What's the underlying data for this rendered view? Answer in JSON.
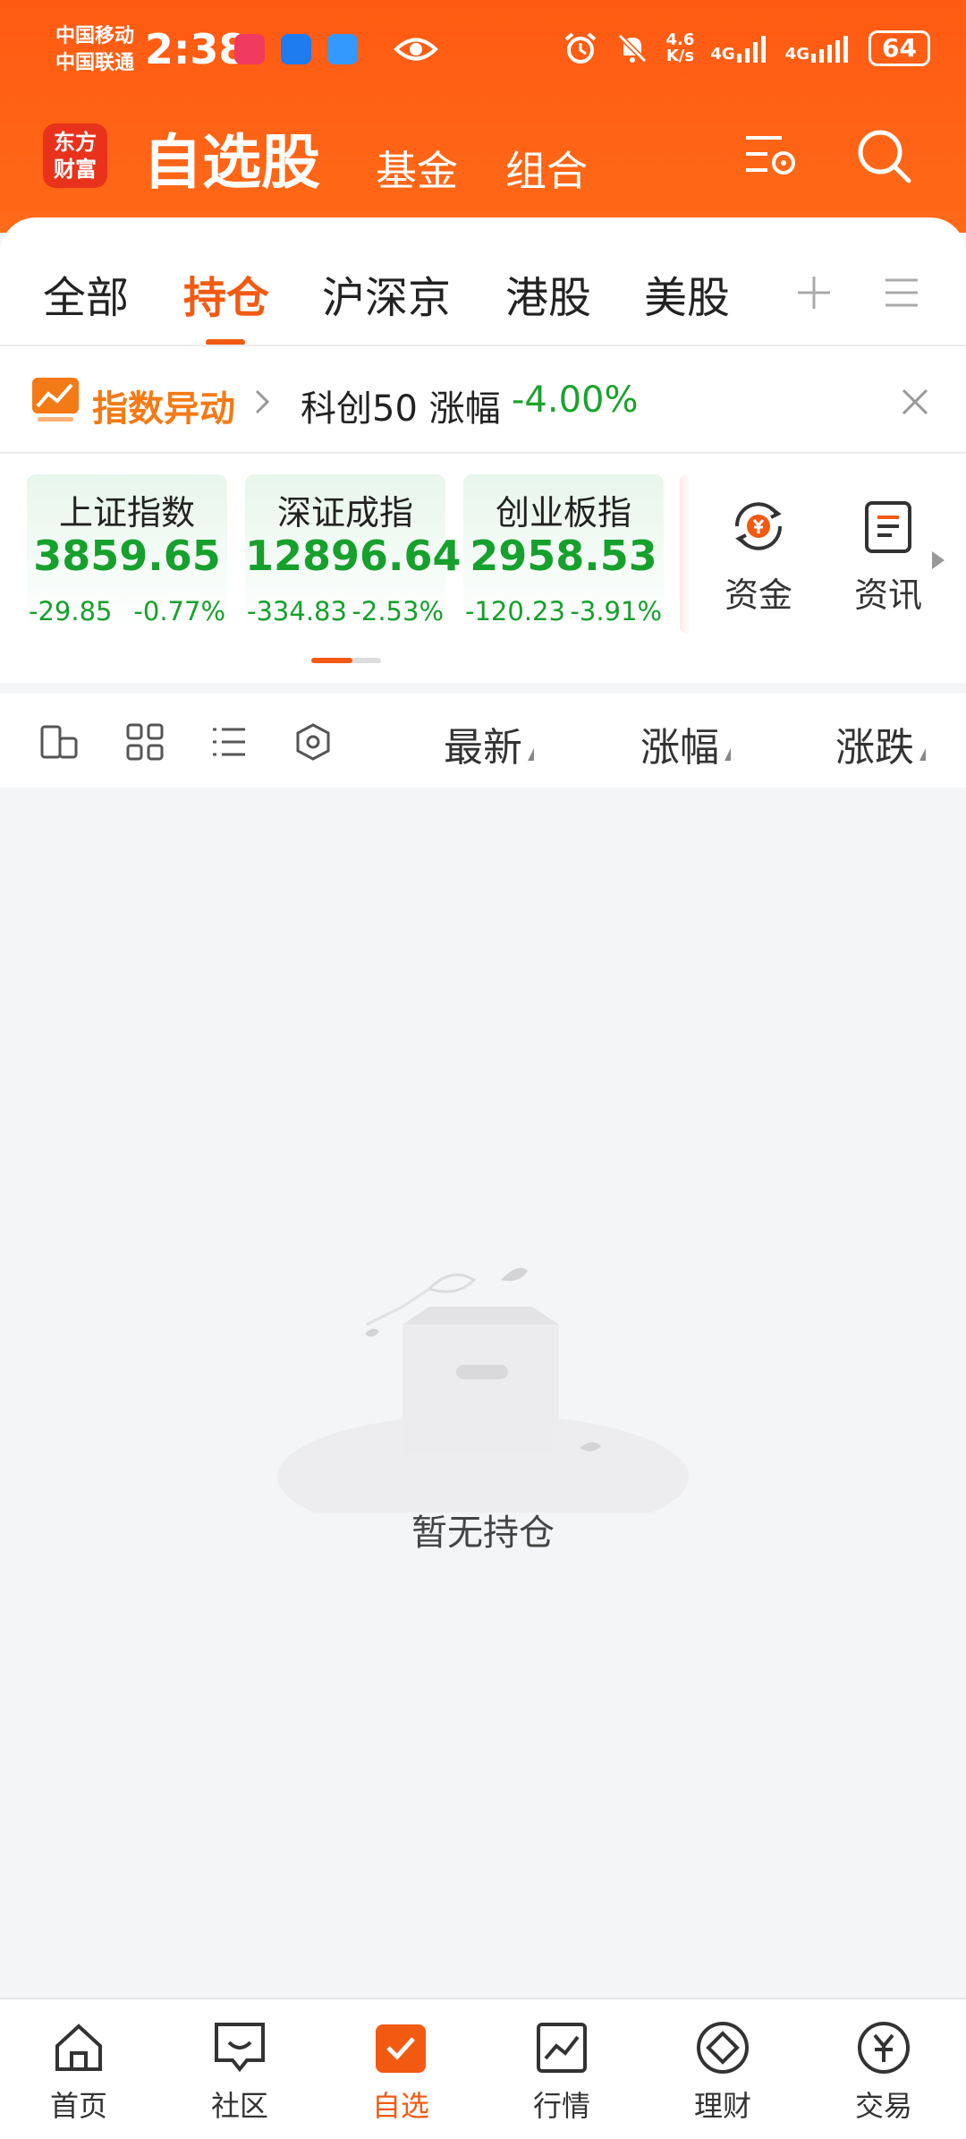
{
  "status_bar": {
    "carrier_1": "中国移动",
    "carrier_2": "中国联通",
    "time": "2:38",
    "net_speed_value": "4.6",
    "net_speed_unit": "K/s",
    "net_1": "4G",
    "net_2": "4G",
    "battery": "64"
  },
  "header": {
    "logo_line1": "东方",
    "logo_line2": "财富",
    "title": "自选股",
    "tab_fund": "基金",
    "tab_portfolio": "组合"
  },
  "tabs": [
    {
      "label": "全部",
      "active": false
    },
    {
      "label": "持仓",
      "active": true
    },
    {
      "label": "沪深京",
      "active": false
    },
    {
      "label": "港股",
      "active": false
    },
    {
      "label": "美股",
      "active": false
    }
  ],
  "alert": {
    "label": "指数异动",
    "text": "科创50 涨幅",
    "percent": "-4.00%"
  },
  "indices": [
    {
      "name": "上证指数",
      "value": "3859.65",
      "change": "-29.85",
      "percent": "-0.77%"
    },
    {
      "name": "深证成指",
      "value": "12896.64",
      "change": "-334.83",
      "percent": "-2.53%"
    },
    {
      "name": "创业板指",
      "value": "2958.53",
      "change": "-120.23",
      "percent": "-3.91%"
    }
  ],
  "quick_links": {
    "funds": "资金",
    "news": "资讯"
  },
  "columns": {
    "latest": "最新",
    "change_pct": "涨幅",
    "change": "涨跌"
  },
  "empty_state": {
    "text": "暂无持仓"
  },
  "bottom_nav": [
    {
      "label": "首页",
      "icon": "home-icon",
      "active": false
    },
    {
      "label": "社区",
      "icon": "community-icon",
      "active": false
    },
    {
      "label": "自选",
      "icon": "watchlist-icon",
      "active": true
    },
    {
      "label": "行情",
      "icon": "market-icon",
      "active": false
    },
    {
      "label": "理财",
      "icon": "wealth-icon",
      "active": false
    },
    {
      "label": "交易",
      "icon": "trade-icon",
      "active": false
    }
  ],
  "colors": {
    "brand": "#ff5a12",
    "accent": "#f25a12",
    "down": "#16a02c"
  }
}
